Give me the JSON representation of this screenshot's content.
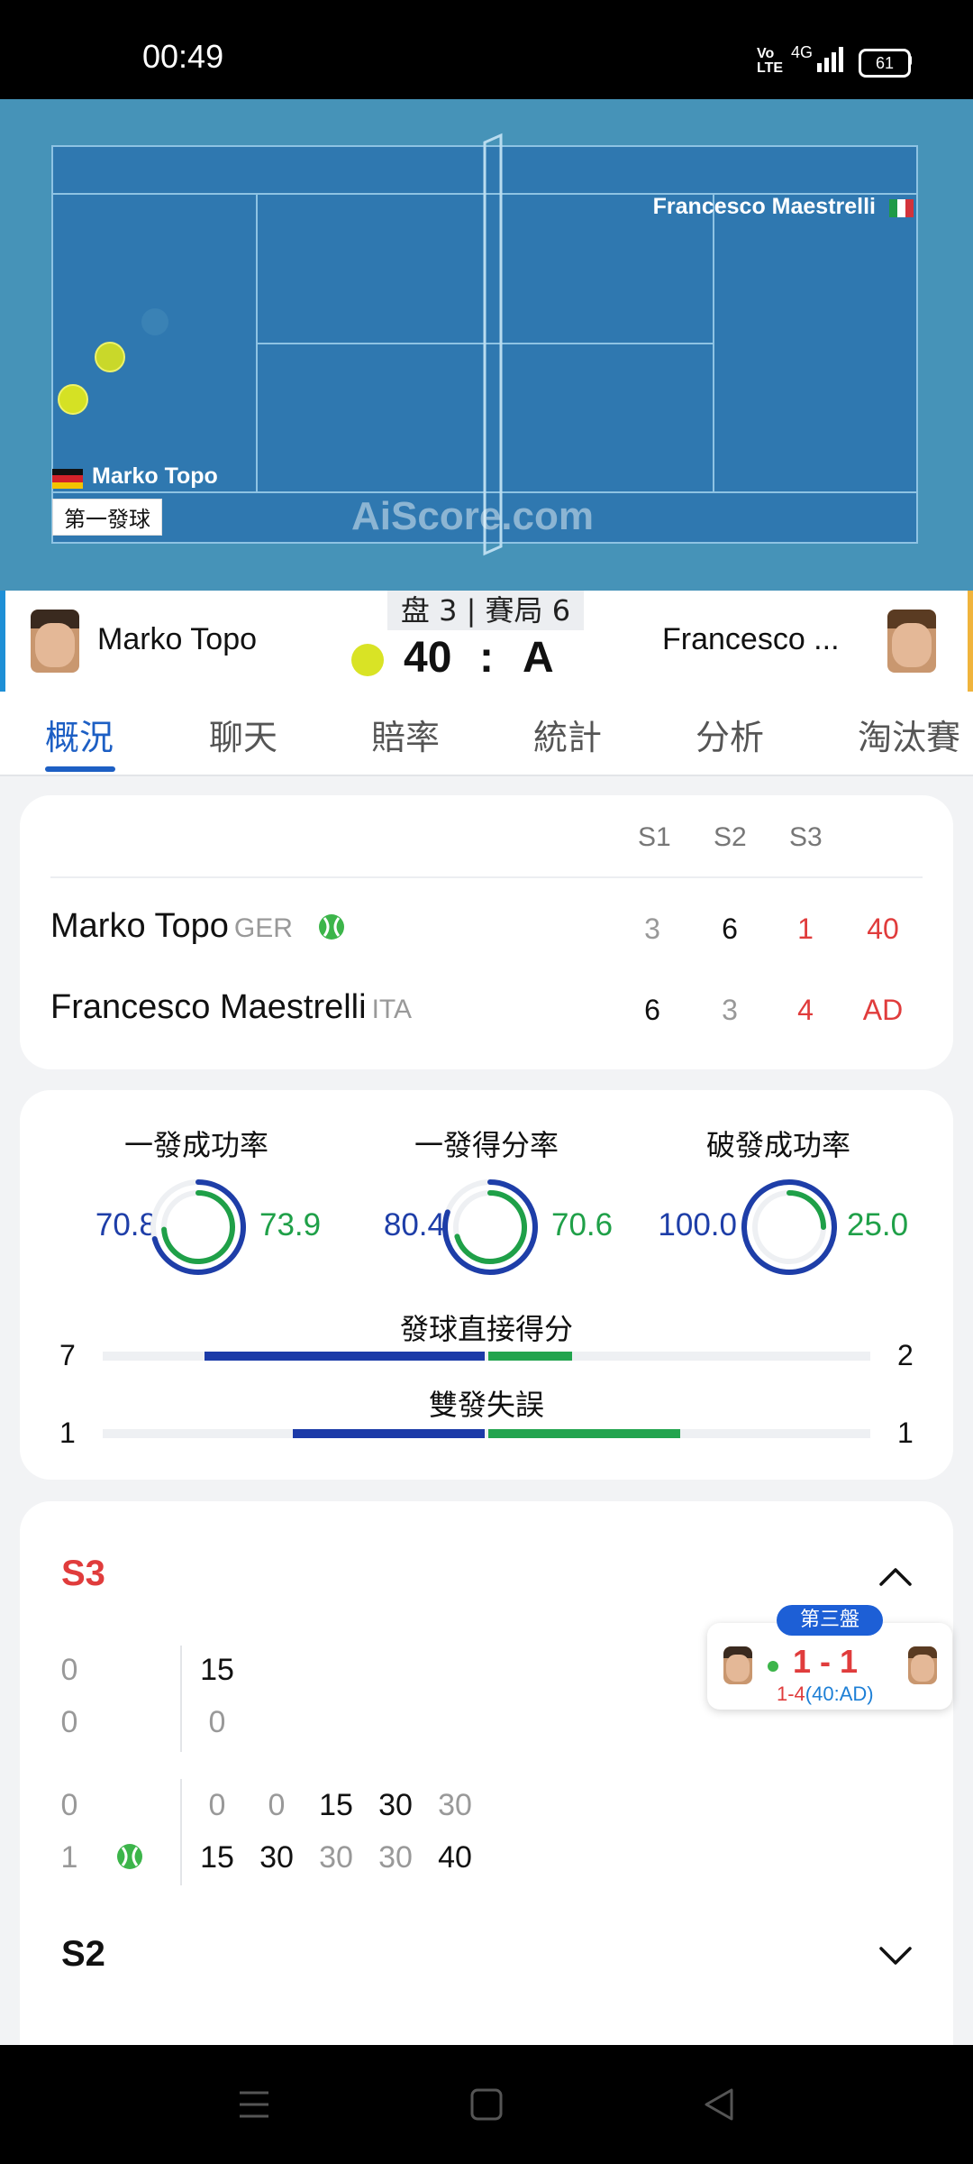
{
  "status_bar": {
    "time": "00:49",
    "volte": "Vo LTE",
    "network": "4G",
    "battery": "61"
  },
  "court": {
    "player_right": "Francesco Maestrelli",
    "player_left": "Marko Topo",
    "serve_label": "第一發球",
    "watermark": "AiScore.com"
  },
  "header": {
    "player_left": "Marko Topo",
    "player_right": "Francesco ...",
    "set_game": "盘 3 | 賽局 6",
    "score_left": "40",
    "colon": ":",
    "score_right": "A"
  },
  "tabs": [
    {
      "label": "概況",
      "active": true
    },
    {
      "label": "聊天"
    },
    {
      "label": "賠率"
    },
    {
      "label": "統計"
    },
    {
      "label": "分析"
    },
    {
      "label": "淘汰賽"
    }
  ],
  "scoreboard": {
    "headers": [
      "S1",
      "S2",
      "S3"
    ],
    "players": [
      {
        "name": "Marko Topo",
        "country": "GER",
        "sets": [
          "3",
          "6",
          "1"
        ],
        "game": "40"
      },
      {
        "name": "Francesco Maestrelli",
        "country": "ITA",
        "sets": [
          "6",
          "3",
          "4"
        ],
        "game": "AD"
      }
    ]
  },
  "stats": {
    "rings": [
      {
        "title": "一發成功率",
        "left": "70.8",
        "right": "73.9",
        "left_frac": 0.708,
        "right_frac": 0.739
      },
      {
        "title": "一發得分率",
        "left": "80.4",
        "right": "70.6",
        "left_frac": 0.804,
        "right_frac": 0.706
      },
      {
        "title": "破發成功率",
        "left": "100.0",
        "right": "25.0",
        "left_frac": 1.0,
        "right_frac": 0.25
      }
    ],
    "bars": [
      {
        "title": "發球直接得分",
        "left": "7",
        "right": "2",
        "left_val": 7,
        "right_val": 2
      },
      {
        "title": "雙發失誤",
        "left": "1",
        "right": "1",
        "left_val": 1,
        "right_val": 1
      }
    ]
  },
  "sets": {
    "s3_label": "S3",
    "s2_label": "S2",
    "game_a": {
      "left": [
        "0",
        "0"
      ],
      "points_top": [
        "15"
      ],
      "points_bottom": [
        "0"
      ]
    },
    "game_b": {
      "left": [
        "0",
        "1"
      ],
      "points_top": [
        "0",
        "0",
        "15",
        "30",
        "30"
      ],
      "points_bottom": [
        "15",
        "30",
        "30",
        "30",
        "40"
      ]
    }
  },
  "popup": {
    "tag": "第三盤",
    "score": "1 - 1",
    "sub_red": "1-4",
    "sub_blue": "(40:AD)"
  },
  "colors": {
    "accent": "#1d5fc4",
    "court_bg": "#4693b8",
    "court": "#2f78b0",
    "red": "#e03c3c",
    "green": "#1fa048",
    "navy": "#1e3ea8"
  }
}
